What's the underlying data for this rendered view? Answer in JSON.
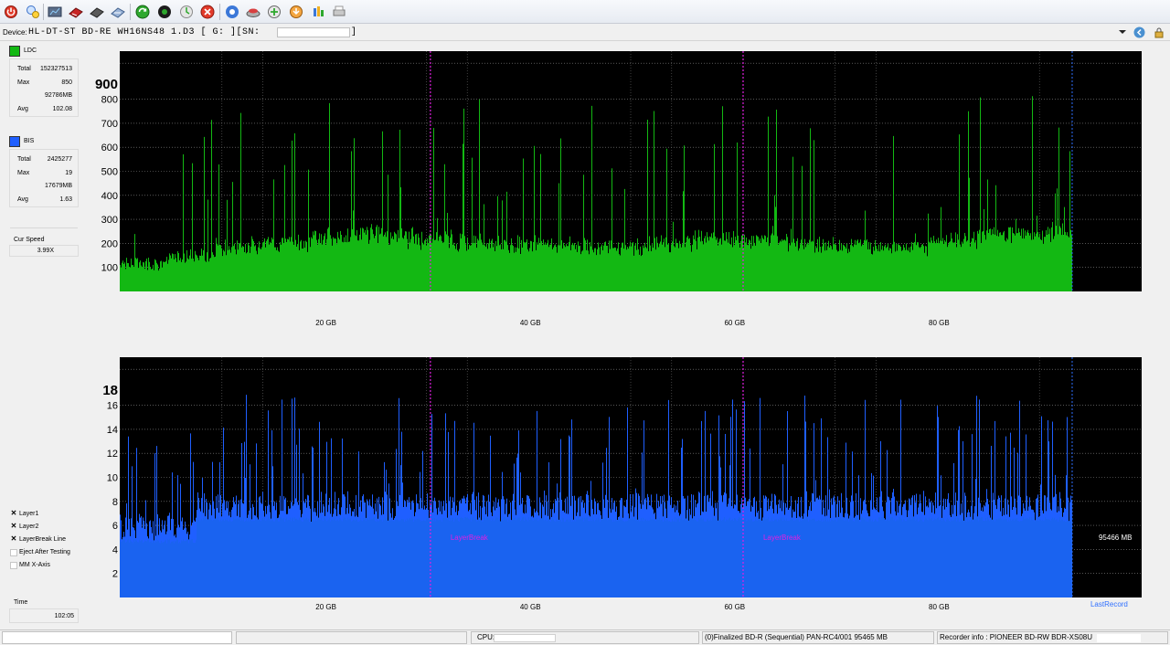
{
  "toolbar": {
    "icons": [
      "power-icon",
      "drive-info-icon",
      "benchmark-icon",
      "disc-erase-icon",
      "disc-info-icon",
      "scan-disc-icon",
      "start-icon",
      "stop-icon",
      "refresh-icon",
      "cancel-icon",
      "settings-icon",
      "disc-eject-icon",
      "screenshot-icon",
      "save-icon",
      "help-icon",
      "print-icon"
    ]
  },
  "device": {
    "label": "Device:",
    "name": "HL-DT-ST BD-RE  WH16NS48  1.D3 [ G: ][SN:",
    "close_bracket": "]"
  },
  "ldc": {
    "name": "LDC",
    "color": "#13b813",
    "total_label": "Total",
    "total": "152327513",
    "max_label": "Max",
    "max": "850",
    "max_pos": "92786MB",
    "avg_label": "Avg",
    "avg": "102.08"
  },
  "bis": {
    "name": "BIS",
    "color": "#1f5fff",
    "total_label": "Total",
    "total": "2425277",
    "max_label": "Max",
    "max": "19",
    "max_pos": "17679MB",
    "avg_label": "Avg",
    "avg": "1.63"
  },
  "speed": {
    "label": "Cur Speed",
    "value": "3.99X"
  },
  "options": [
    {
      "label": "Layer1",
      "checked": true
    },
    {
      "label": "Layer2",
      "checked": true
    },
    {
      "label": "LayerBreak Line",
      "checked": true
    },
    {
      "label": "Eject After Testing",
      "checked": false
    },
    {
      "label": "MM X-Axis",
      "checked": false
    }
  ],
  "time": {
    "label": "Time",
    "value": "102:05"
  },
  "chart_data": [
    {
      "type": "bar",
      "series_name": "LDC",
      "color": "#13b813",
      "x_unit": "GB",
      "xlim": [
        0,
        100
      ],
      "ylim": [
        0,
        1000
      ],
      "y_top_label": "900",
      "y_ticks": [
        100,
        200,
        300,
        400,
        500,
        600,
        700,
        800
      ],
      "x_ticks": [
        "20 GB",
        "40 GB",
        "60 GB",
        "80 GB"
      ],
      "x_tick_values": [
        20,
        40,
        60,
        80
      ],
      "layer_breaks": [
        30.4,
        61.0
      ],
      "end_marker": 93.2,
      "baseline": [
        100,
        130,
        170,
        190,
        210,
        220,
        200,
        190,
        180,
        175,
        170,
        180,
        200,
        200,
        180,
        175,
        170,
        200,
        220,
        230
      ]
    },
    {
      "type": "bar",
      "series_name": "BIS",
      "color": "#1f5fff",
      "x_unit": "GB",
      "xlim": [
        0,
        100
      ],
      "ylim": [
        0,
        20
      ],
      "y_top_label": "18",
      "y_ticks": [
        2,
        4,
        6,
        8,
        10,
        12,
        14,
        16
      ],
      "x_ticks": [
        "20 GB",
        "40 GB",
        "60 GB",
        "80 GB"
      ],
      "x_tick_values": [
        20,
        40,
        60,
        80
      ],
      "layer_breaks": [
        30.4,
        61.0
      ],
      "layer_break_label": "LayerBreak",
      "end_marker": 93.2,
      "end_label": "95466 MB",
      "last_record_label": "LastRecord"
    }
  ],
  "status": {
    "cpu_label": "CPU:",
    "disc": "(0)Finalized  BD-R (Sequential)  PAN-RC4/001  95465 MB",
    "recorder": "Recorder info : PIONEER       BD-RW  BDR-XS08U"
  }
}
